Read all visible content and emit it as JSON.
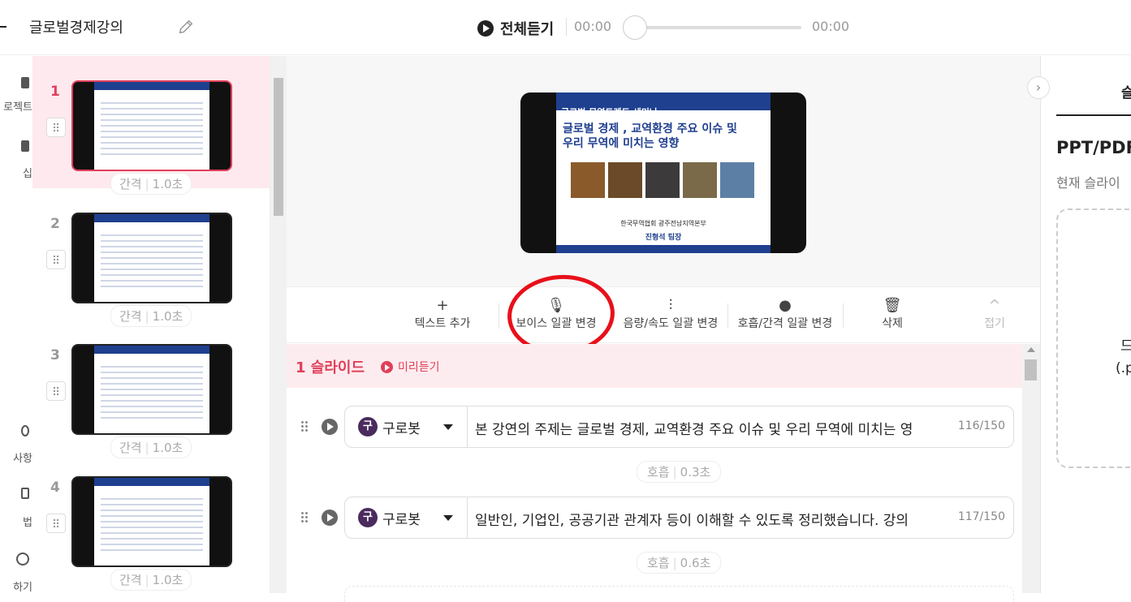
{
  "header": {
    "project_title": "글로벌경제강의",
    "play_all_label": "전체듣기",
    "time_current": "00:00",
    "time_total": "00:00",
    "progress": 0
  },
  "left_nav": {
    "items": [
      {
        "label": "로젝트",
        "icon": "folder-icon"
      },
      {
        "label": "십",
        "icon": "edit-icon"
      },
      {
        "label": "사항",
        "icon": "notice-icon"
      },
      {
        "label": "법",
        "icon": "guide-icon"
      },
      {
        "label": "하기",
        "icon": "help-icon"
      }
    ]
  },
  "slides": [
    {
      "number": "1",
      "gap_label": "간격",
      "gap_value": "1.0초",
      "active": true
    },
    {
      "number": "2",
      "gap_label": "간격",
      "gap_value": "1.0초",
      "active": false
    },
    {
      "number": "3",
      "gap_label": "간격",
      "gap_value": "1.0초",
      "active": false
    },
    {
      "number": "4",
      "gap_label": "간격",
      "gap_value": "1.0초",
      "active": false
    }
  ],
  "main_slide": {
    "eyebrow": "글로벌 무역트렌드 세미나",
    "title_line1": "글로벌 경제 , 교역환경 주요 이슈 및",
    "title_line2": "우리 무역에 미치는 영향",
    "org": "한국무역협회 광주전남지역본부",
    "presenter": "진형석 팀장"
  },
  "toolbar": {
    "add_text": "텍스트 추가",
    "voice_bulk": "보이스 일괄 변경",
    "volume_speed_bulk": "음량/속도 일괄 변경",
    "breath_gap_bulk": "호흡/간격 일괄 변경",
    "delete": "삭제",
    "collapse": "접기"
  },
  "editor": {
    "slide_label": "1 슬라이드",
    "preview_label": "미리듣기",
    "lines": [
      {
        "voice_avatar": "구",
        "voice_name": "구로봇",
        "text": "본 강연의 주제는 글로벌 경제, 교역환경 주요 이슈 및 우리 무역에 미치는 영",
        "count": "116/150",
        "breath_label": "호흡",
        "breath_value": "0.3초"
      },
      {
        "voice_avatar": "구",
        "voice_name": "구로봇",
        "text": "일반인, 기업인, 공공기관 관계자 등이 이해할 수 있도록 정리했습니다. 강의",
        "count": "117/150",
        "breath_label": "호흡",
        "breath_value": "0.6초"
      }
    ]
  },
  "right_panel": {
    "tab": "슬",
    "title": "PPT/PDF",
    "subtitle": "현재 슬라이",
    "dropzone_line1": "드",
    "dropzone_line2": "(.p"
  },
  "colors": {
    "accent": "#e0405a",
    "accent_bg": "#fdecef",
    "slide_navy": "#1f3f8f",
    "annotation_red": "#e8101a"
  }
}
